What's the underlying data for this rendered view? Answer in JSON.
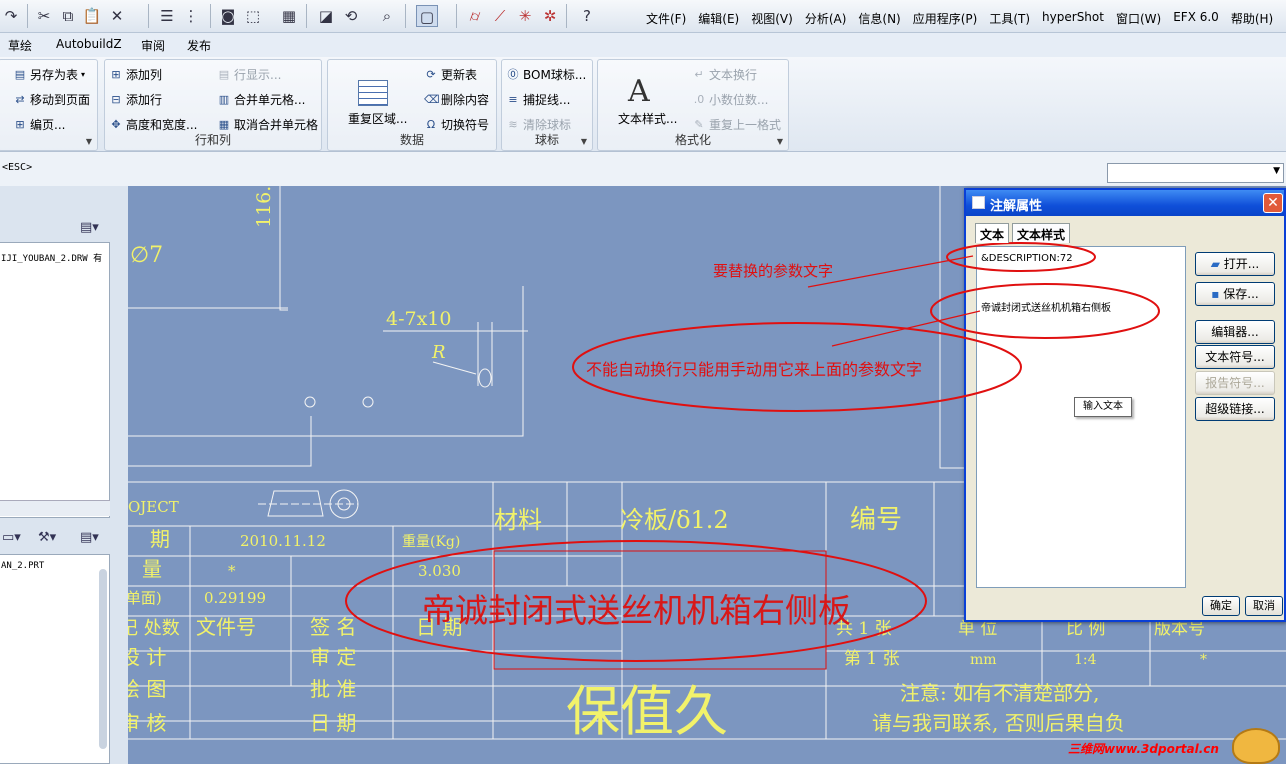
{
  "menubar": [
    "文件(F)",
    "编辑(E)",
    "视图(V)",
    "分析(A)",
    "信息(N)",
    "应用程序(P)",
    "工具(T)",
    "hyperShot",
    "窗口(W)",
    "EFX 6.0",
    "帮助(H)"
  ],
  "ribbon_tabs": [
    "草绘",
    "AutobuildZ",
    "审阅",
    "发布"
  ],
  "ribbon": {
    "g1": {
      "save_as_table": "另存为表",
      "move_to_page": "移动到页面",
      "page": "编页..."
    },
    "rows_cols": {
      "title": "行和列",
      "add_col": "添加列",
      "add_row": "添加行",
      "height_width": "高度和宽度...",
      "row_display": "行显示...",
      "merge": "合并单元格...",
      "unmerge": "取消合并单元格"
    },
    "data": {
      "title": "数据",
      "repeat_region": "重复区域...",
      "update_table": "更新表",
      "delete_content": "删除内容",
      "switch_symbol": "切换符号"
    },
    "balloon": {
      "title": "球标",
      "bom_balloon": "BOM球标...",
      "snap_line": "捕捉线...",
      "clear_balloon": "清除球标"
    },
    "format": {
      "title": "格式化",
      "text_style": "文本样式...",
      "text_wrap": "文本换行",
      "decimal": "小数位数...",
      "repeat_format": "重复上一格式"
    }
  },
  "message": {
    "esc": "<ESC>"
  },
  "left": {
    "drawing_file": "IJI_YOUBAN_2.DRW 有",
    "part_file": "AN_2.PRT"
  },
  "drawing": {
    "dim_116": "116.",
    "dia7": "∅7",
    "dim_4_7x10": "4-7x10",
    "r_label": "R",
    "object": "OJECT",
    "date_label": "期",
    "date_value": "2010.11.12",
    "weight_label": "重量(Kg)",
    "qty_label": "量",
    "qty_value": "*",
    "weight_value": "3.030",
    "single_label": "(单面)",
    "area_value": "0.29199",
    "material_label": "材料",
    "material_value": "冷板/δ1.2",
    "number_label": "编号",
    "row_mark": "记 处数",
    "file_no": "文件号",
    "sign": "签 名",
    "date": "日 期",
    "total_sheets": "共 1 张",
    "unit_label": "单 位",
    "ratio_label": "比 例",
    "version_label": "版本号",
    "design": "设 计",
    "review": "审 定",
    "sheet_no": "第 1 张",
    "unit_value": "mm",
    "ratio_value": "1:4",
    "version_value": "*",
    "draw": "绘 图",
    "approve": "批 准",
    "check": "审 核",
    "date2": "日 期",
    "company": "保值久",
    "note1": "注意: 如有不清楚部分,",
    "note2": "请与我司联系, 否则后果自负",
    "title_in_box": "帝诚封闭式送丝机机箱右侧板"
  },
  "dialog": {
    "title": "注解属性",
    "tab_text": "文本",
    "tab_style": "文本样式",
    "line1": "&DESCRIPTION:72",
    "line2": "帝诚封闭式送丝机机箱右侧板",
    "open": "打开...",
    "save": "保存...",
    "editor": "编辑器...",
    "text_symbol": "文本符号...",
    "report_symbol": "报告符号...",
    "hyperlink": "超级链接...",
    "ok": "确定",
    "cancel": "取消",
    "tooltip": "输入文本"
  },
  "annotations": {
    "param_text": "要替换的参数文字",
    "manual_wrap": "不能自动换行只能用手动用它来上面的参数文字"
  },
  "watermark": "三维网www.3dportal.cn",
  "colors": {
    "canvas": "#7c96c0",
    "cad_text": "#f2f26a",
    "annotation": "#e01010",
    "dialog_title": "#0f4fd9"
  }
}
